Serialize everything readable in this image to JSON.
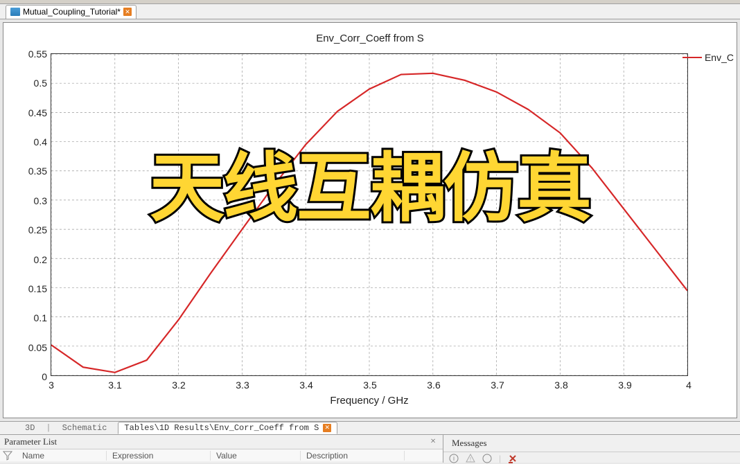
{
  "tab": {
    "label": "Mutual_Coupling_Tutorial*"
  },
  "chart_data": {
    "type": "line",
    "title": "Env_Corr_Coeff from S",
    "xlabel": "Frequency / GHz",
    "ylabel": "",
    "xlim": [
      3.0,
      4.0
    ],
    "ylim": [
      0,
      0.55
    ],
    "x_ticks": [
      3,
      3.1,
      3.2,
      3.3,
      3.4,
      3.5,
      3.6,
      3.7,
      3.8,
      3.9,
      4
    ],
    "y_ticks": [
      0,
      0.05,
      0.1,
      0.15,
      0.2,
      0.25,
      0.3,
      0.35,
      0.4,
      0.45,
      0.5,
      0.55
    ],
    "series": [
      {
        "name": "Env_C",
        "color": "#d62728",
        "x": [
          3.0,
          3.05,
          3.1,
          3.15,
          3.2,
          3.25,
          3.3,
          3.35,
          3.4,
          3.45,
          3.5,
          3.55,
          3.6,
          3.65,
          3.7,
          3.75,
          3.8,
          3.85,
          3.9,
          3.95,
          4.0
        ],
        "y": [
          0.052,
          0.014,
          0.005,
          0.026,
          0.095,
          0.174,
          0.25,
          0.325,
          0.395,
          0.452,
          0.49,
          0.515,
          0.517,
          0.505,
          0.485,
          0.455,
          0.415,
          0.355,
          0.285,
          0.215,
          0.145
        ]
      }
    ]
  },
  "legend_clip": "Env_C",
  "overlay": "天线互耦仿真",
  "bottom_tabs": {
    "t1": "3D",
    "t2": "Schematic",
    "t3": "Tables\\1D Results\\Env_Corr_Coeff from S"
  },
  "panels": {
    "param_title": "Parameter List",
    "msg_title": "Messages",
    "cols": {
      "name": "Name",
      "expr": "Expression",
      "val": "Value",
      "desc": "Description"
    }
  }
}
